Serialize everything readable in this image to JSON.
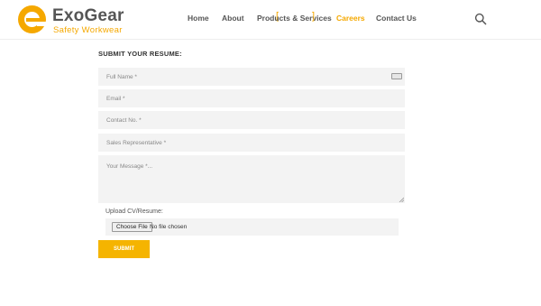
{
  "brand": {
    "name": "ExoGear",
    "tagline": "Safety Workwear",
    "accent_color": "#f5a800"
  },
  "nav": {
    "items": [
      {
        "label": "Home",
        "active": false
      },
      {
        "label": "About",
        "active": false
      },
      {
        "label": "Products & Services",
        "active": false
      },
      {
        "label": "Careers",
        "active": true
      },
      {
        "label": "Contact Us",
        "active": false
      }
    ],
    "search_icon": "search-icon"
  },
  "form": {
    "title": "SUBMIT YOUR RESUME:",
    "full_name_placeholder": "Full Name *",
    "email_placeholder": "Email *",
    "contact_placeholder": "Contact No. *",
    "position_value": "Sales Representative *",
    "message_placeholder": "Your Message *...",
    "upload_label": "Upload CV/Resume:",
    "choose_file_label": "Choose File",
    "file_status": "No file chosen",
    "submit_label": "SUBMIT"
  }
}
